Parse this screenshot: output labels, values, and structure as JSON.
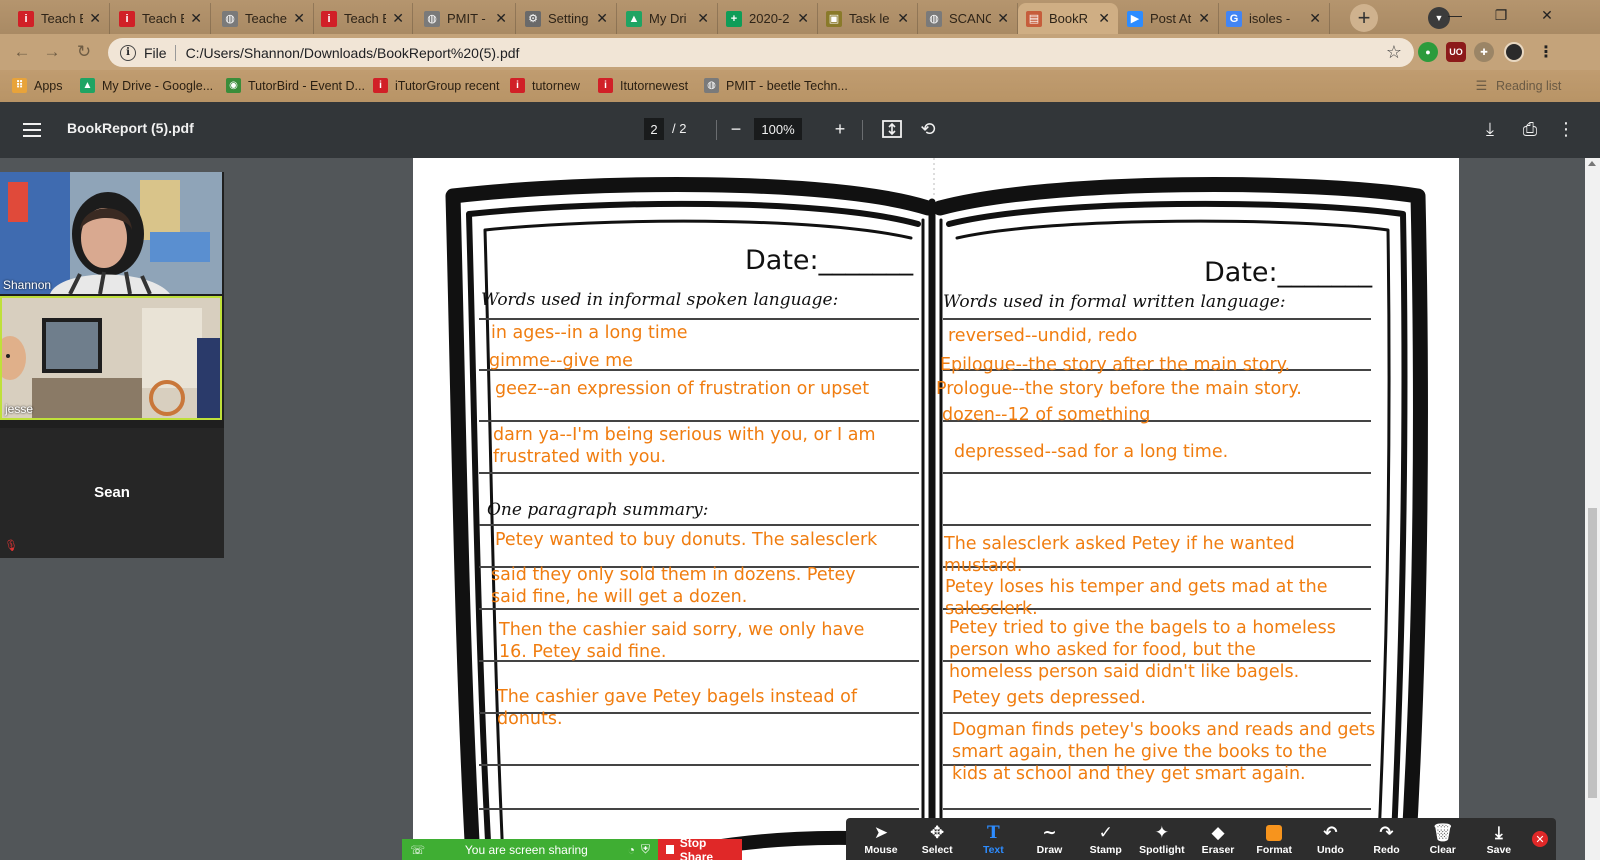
{
  "browser": {
    "tabs": [
      {
        "label": "Teach E",
        "fav": "i",
        "color": "#d12027"
      },
      {
        "label": "Teach E",
        "fav": "i",
        "color": "#d12027"
      },
      {
        "label": "Teache",
        "fav": "◍",
        "color": "#7a7a7a"
      },
      {
        "label": "Teach E",
        "fav": "i",
        "color": "#d12027"
      },
      {
        "label": "PMIT -",
        "fav": "◍",
        "color": "#7a7a7a"
      },
      {
        "label": "Setting",
        "fav": "⚙",
        "color": "#6a6a6a"
      },
      {
        "label": "My Dri",
        "fav": "▲",
        "color": "#1fa463"
      },
      {
        "label": "2020-2",
        "fav": "+",
        "color": "#0f9d58"
      },
      {
        "label": "Task le",
        "fav": "▣",
        "color": "#8a7a2a"
      },
      {
        "label": "SCANO",
        "fav": "◍",
        "color": "#7a7a7a"
      },
      {
        "label": "BookR",
        "fav": "▤",
        "color": "#c65d3b"
      },
      {
        "label": "Post At",
        "fav": "▶",
        "color": "#2d8cff"
      },
      {
        "label": "isoles -",
        "fav": "G",
        "color": "#4285f4"
      }
    ],
    "address": {
      "info": "i",
      "scheme": "File",
      "url": "C:/Users/Shannon/Downloads/BookReport%20(5).pdf"
    },
    "bookmarks": [
      {
        "label": "Apps",
        "icon": "apps-icon",
        "color": "#e8a33a",
        "glyph": "⠿"
      },
      {
        "label": "My Drive - Google...",
        "icon": "drive-icon",
        "color": "#1fa463",
        "glyph": "▲"
      },
      {
        "label": "TutorBird - Event D...",
        "icon": "tutorbird-icon",
        "color": "#3a8d3a",
        "glyph": "◉"
      },
      {
        "label": "iTutorGroup recent",
        "icon": "itutor-icon",
        "color": "#d12027",
        "glyph": "i"
      },
      {
        "label": "tutornew",
        "icon": "itutor-icon",
        "color": "#d12027",
        "glyph": "i"
      },
      {
        "label": "Itutornewest",
        "icon": "itutor-icon",
        "color": "#d12027",
        "glyph": "i"
      },
      {
        "label": "PMIT - beetle Techn...",
        "icon": "globe-icon",
        "color": "#7a7a7a",
        "glyph": "◍"
      }
    ],
    "reading_list": "Reading list"
  },
  "pdf": {
    "title": "BookReport (5).pdf",
    "page_current": "2",
    "page_total": "/  2",
    "zoom": "100%"
  },
  "worksheet": {
    "left": {
      "date": "Date:_______",
      "heading1": "Words used in informal spoken language:",
      "heading2": "One paragraph summary:",
      "answers": [
        "in ages--in a long time",
        "gimme--give me",
        "geez--an expression of frustration or upset",
        "darn ya--I'm being serious with you, or I am",
        "frustrated with you.",
        "Petey wanted to buy donuts. The salesclerk",
        "said they only sold them in dozens. Petey",
        "said fine, he will get a dozen.",
        "Then the cashier said sorry, we only have",
        "16.  Petey said fine.",
        "The cashier gave Petey bagels instead of",
        "donuts."
      ]
    },
    "right": {
      "date": "Date:_______",
      "heading1": "Words used in formal written language:",
      "answers": [
        "reversed--undid, redo",
        "Epilogue--the story after the main story.",
        "Prologue--the story before the main story.",
        "dozen--12 of something",
        "depressed--sad for a long time.",
        "The salesclerk asked Petey if he wanted",
        "mustard.",
        "Petey loses his temper and gets mad at the",
        "salesclerk.",
        "Petey tried to give the bagels to a homeless",
        "person who asked for food, but the",
        "homeless person said didn't like bagels.",
        "Petey gets depressed.",
        "Dogman finds petey's books and reads and gets",
        "smart again, then he give the books to the",
        "kids at school and they get smart again."
      ]
    },
    "answer_color": "#f07d10"
  },
  "zoom": {
    "participants": [
      {
        "name": "Shannon"
      },
      {
        "name": "jesse"
      },
      {
        "name": "Sean"
      }
    ],
    "sharing_text": "You are screen sharing",
    "stop_share": "Stop Share",
    "tools": [
      {
        "label": "Mouse",
        "icon": "mouse-pointer-icon",
        "glyph": "➤"
      },
      {
        "label": "Select",
        "icon": "move-icon",
        "glyph": "✥"
      },
      {
        "label": "Text",
        "icon": "text-icon",
        "glyph": "T"
      },
      {
        "label": "Draw",
        "icon": "draw-icon",
        "glyph": "∼"
      },
      {
        "label": "Stamp",
        "icon": "checkmark-icon",
        "glyph": "✓"
      },
      {
        "label": "Spotlight",
        "icon": "spotlight-icon",
        "glyph": "✦"
      },
      {
        "label": "Eraser",
        "icon": "eraser-icon",
        "glyph": "◆"
      },
      {
        "label": "Format",
        "icon": "color-swatch-icon",
        "glyph": ""
      },
      {
        "label": "Undo",
        "icon": "undo-icon",
        "glyph": "↶"
      },
      {
        "label": "Redo",
        "icon": "redo-icon",
        "glyph": "↷"
      },
      {
        "label": "Clear",
        "icon": "trash-icon",
        "glyph": "🗑"
      },
      {
        "label": "Save",
        "icon": "save-icon",
        "glyph": "⤓"
      }
    ],
    "active_tool": "Text",
    "active_color": "#2d8cff",
    "format_color": "#f7941d"
  }
}
